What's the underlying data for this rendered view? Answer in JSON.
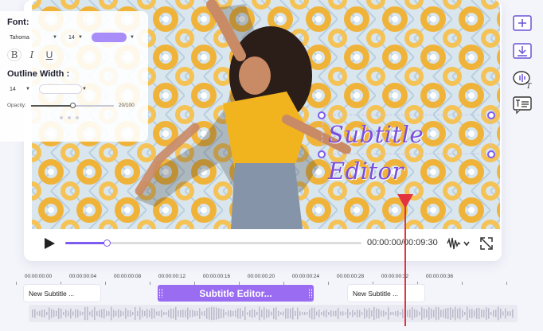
{
  "panel": {
    "font_label": "Font:",
    "font_family": "Tahoma",
    "font_size": "14",
    "font_color": "#a88cf8",
    "bold": "B",
    "italic": "I",
    "underline": "U",
    "outline_label": "Outline Width :",
    "outline_size": "14",
    "outline_color": "#ffffff",
    "opacity_label": "Opacity:",
    "opacity_value": "20/100",
    "opacity_fraction": 0.2
  },
  "subtitle": {
    "text": "Subtitle Editor"
  },
  "player": {
    "progress": 0.14,
    "time": "00:00:00/00:09:30"
  },
  "toolbar": {
    "icons": [
      "add-subtitle-icon",
      "import-subtitle-icon",
      "speech-to-text-icon",
      "text-to-speech-icon"
    ]
  },
  "timeline": {
    "ticks": [
      "00:00:00:00",
      "00:00:00:04",
      "00:00:00:08",
      "00:00:00:12",
      "00:00:00:16",
      "00:00:00:20",
      "00:00:00:24",
      "00:00:00:28",
      "00:00:00:32",
      "00:00:00:36"
    ],
    "clips": [
      {
        "label": "New Subtitle ...",
        "selected": false
      },
      {
        "label": "Subtitle Editor...",
        "selected": true
      },
      {
        "label": "New Subtitle ...",
        "selected": false
      }
    ]
  },
  "colors": {
    "accent": "#7c5cf0",
    "playhead": "#e2333f"
  }
}
